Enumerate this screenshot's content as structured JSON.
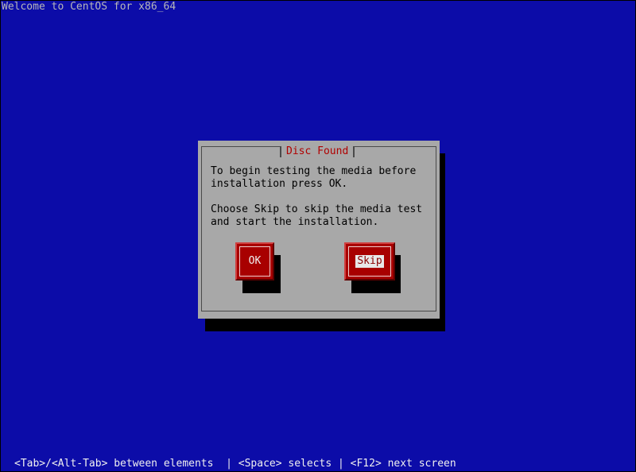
{
  "screen": {
    "title": "Welcome to CentOS for x86_64",
    "help_text": "<Tab>/<Alt-Tab> between elements  | <Space> selects | <F12> next screen"
  },
  "dialog": {
    "title": "Disc Found",
    "message": "To begin testing the media before\ninstallation press OK.\n\nChoose Skip to skip the media test\nand start the installation.",
    "buttons": {
      "ok_label": "OK",
      "skip_label": "Skip"
    },
    "focused_button": "Skip"
  },
  "colors": {
    "background": "#0c0ca8",
    "dialog": "#a8a8a8",
    "title_text": "#b00000",
    "button": "#a80000"
  }
}
